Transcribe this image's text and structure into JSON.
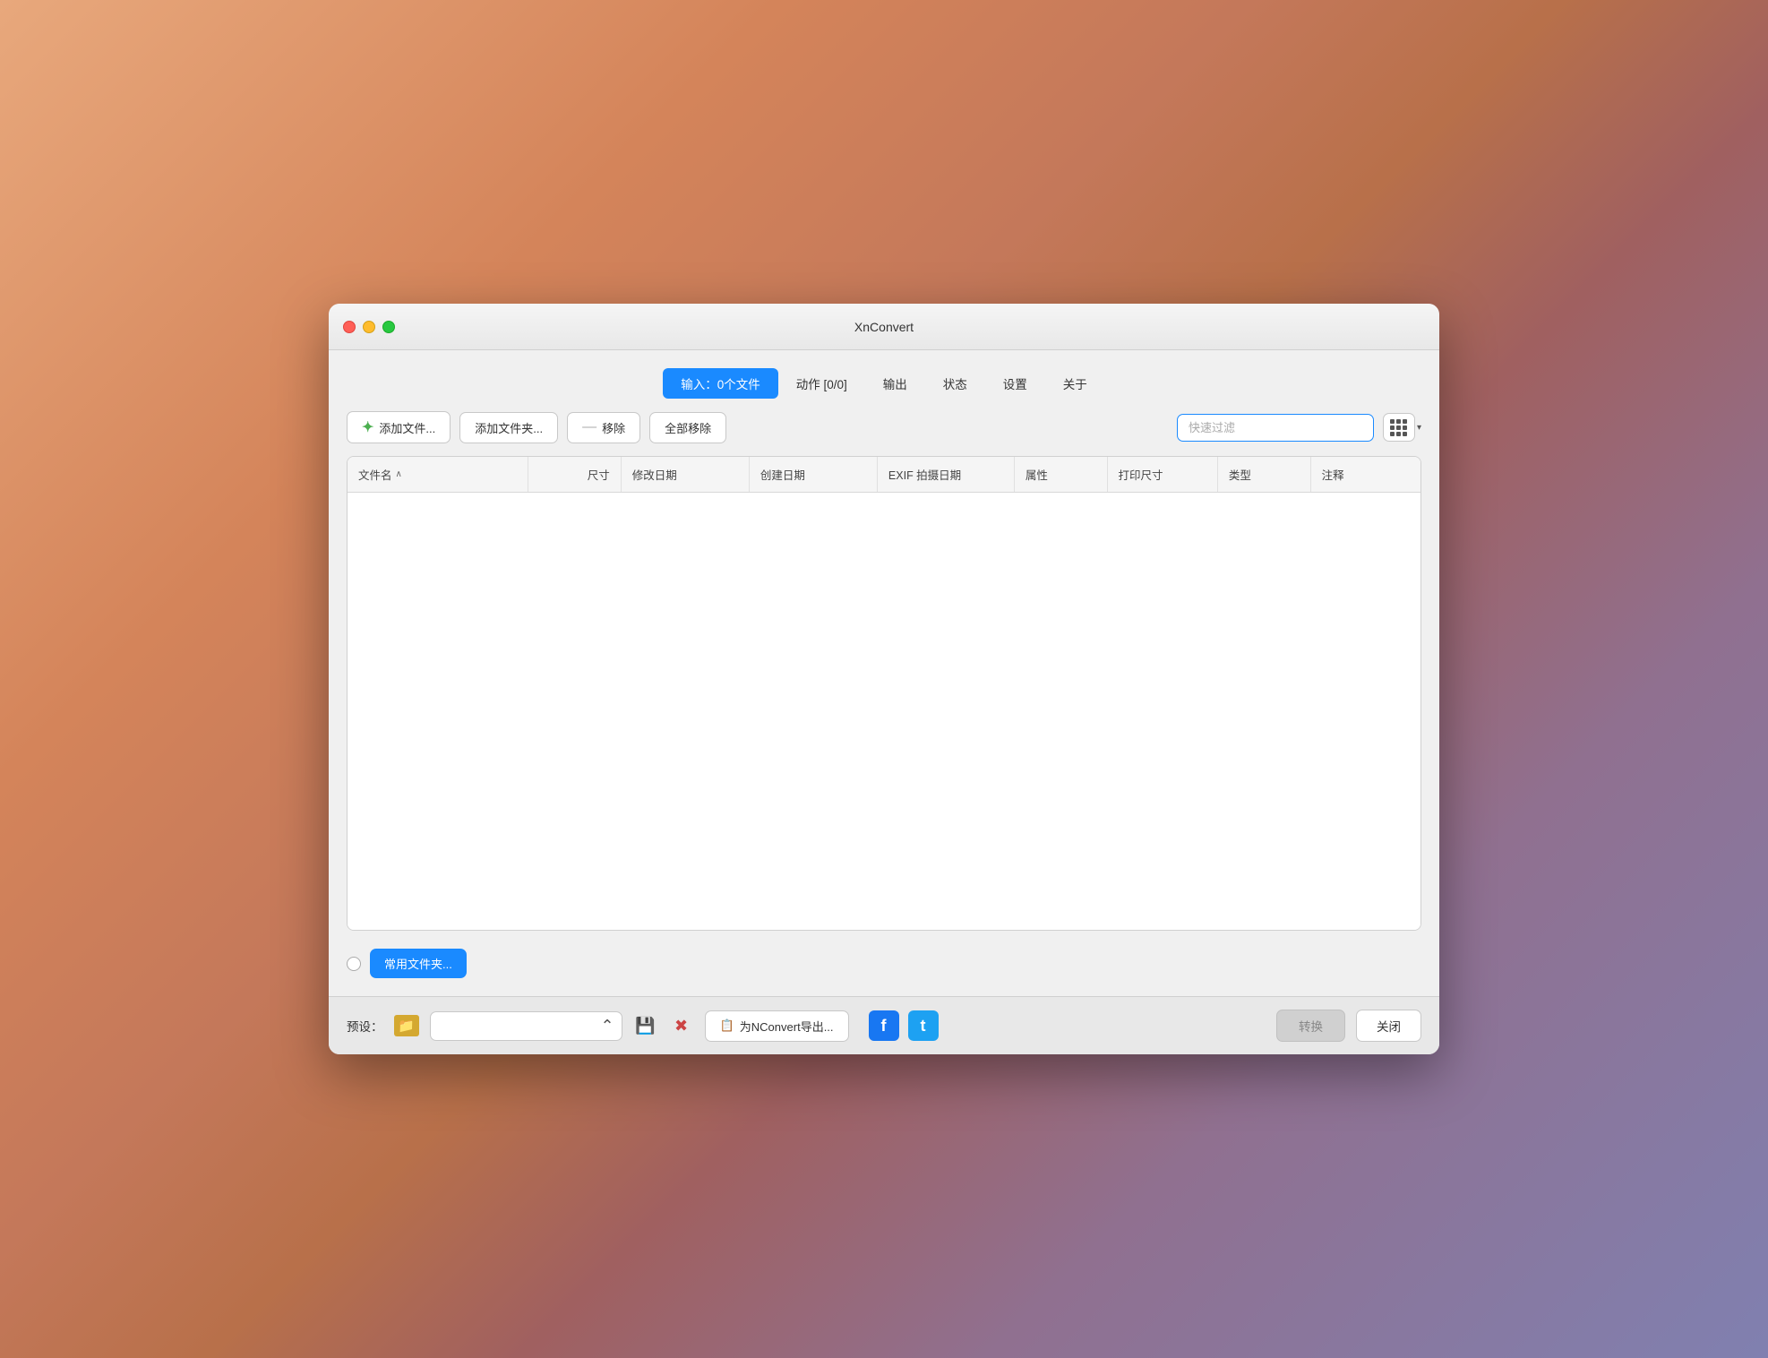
{
  "window": {
    "title": "XnConvert"
  },
  "tabs": [
    {
      "id": "input",
      "label": "输入：0个文件",
      "active": true
    },
    {
      "id": "actions",
      "label": "动作 [0/0]",
      "active": false
    },
    {
      "id": "output",
      "label": "输出",
      "active": false
    },
    {
      "id": "status",
      "label": "状态",
      "active": false
    },
    {
      "id": "settings",
      "label": "设置",
      "active": false
    },
    {
      "id": "about",
      "label": "关于",
      "active": false
    }
  ],
  "toolbar": {
    "add_files_label": "添加文件...",
    "add_folder_label": "添加文件夹...",
    "remove_label": "移除",
    "remove_all_label": "全部移除",
    "filter_placeholder": "快速过滤"
  },
  "table": {
    "columns": [
      {
        "id": "filename",
        "label": "文件名",
        "sortable": true
      },
      {
        "id": "size",
        "label": "尺寸"
      },
      {
        "id": "modified",
        "label": "修改日期"
      },
      {
        "id": "created",
        "label": "创建日期"
      },
      {
        "id": "exif",
        "label": "EXIF 拍摄日期"
      },
      {
        "id": "attributes",
        "label": "属性"
      },
      {
        "id": "print_size",
        "label": "打印尺寸"
      },
      {
        "id": "type",
        "label": "类型"
      },
      {
        "id": "note",
        "label": "注释"
      }
    ],
    "rows": []
  },
  "bottom": {
    "common_folder_label": "常用文件夹..."
  },
  "footer": {
    "preset_label": "预设：",
    "export_label": "为NConvert导出...",
    "convert_label": "转换",
    "close_label": "关闭"
  },
  "icons": {
    "add": "➕",
    "folder": "📁",
    "remove": "—",
    "grid": "⊞",
    "save": "💾",
    "delete": "✖",
    "export": "📋",
    "facebook": "f",
    "twitter": "t",
    "chevron_down": "▾",
    "sort_up": "∧"
  },
  "colors": {
    "active_tab": "#1a8aff",
    "add_icon": "#4caf50",
    "remove_icon": "#888888",
    "facebook": "#1877f2",
    "twitter": "#1da1f2",
    "convert_disabled": "#d0d0d0"
  }
}
